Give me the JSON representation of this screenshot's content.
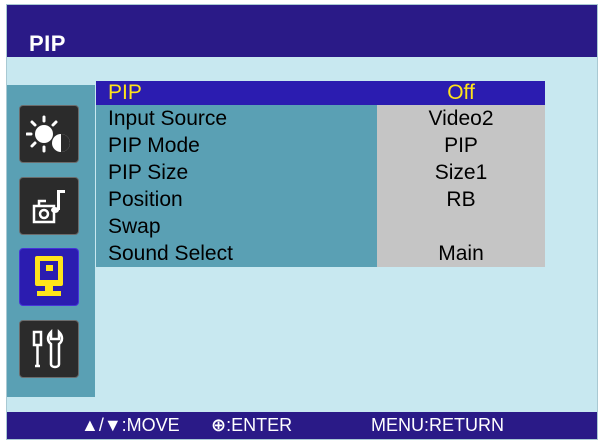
{
  "osd": {
    "title": "PIP",
    "sidebar": {
      "items": [
        {
          "icon": "brightness-contrast-icon",
          "active": false
        },
        {
          "icon": "audio-settings-icon",
          "active": false
        },
        {
          "icon": "pip-monitor-icon",
          "active": true
        },
        {
          "icon": "tools-icon",
          "active": false
        }
      ]
    },
    "menu": {
      "rows": [
        {
          "label": "PIP",
          "value": "Off",
          "selected": true
        },
        {
          "label": "Input Source",
          "value": "Video2",
          "selected": false
        },
        {
          "label": "PIP Mode",
          "value": "PIP",
          "selected": false
        },
        {
          "label": "PIP Size",
          "value": "Size1",
          "selected": false
        },
        {
          "label": "Position",
          "value": "RB",
          "selected": false
        },
        {
          "label": "Swap",
          "value": "",
          "selected": false
        },
        {
          "label": "Sound Select",
          "value": "Main",
          "selected": false
        }
      ]
    },
    "footer": {
      "move_label": "▲/▼:MOVE",
      "enter_symbol": "⊕",
      "enter_label": ":ENTER",
      "return_label": "MENU:RETURN"
    },
    "colors": {
      "title_bar": "#2a1a87",
      "background": "#c8e8f0",
      "label_column": "#5aa0b4",
      "value_column": "#c5c5c5",
      "selected_background": "#2b1cb0",
      "selected_text": "#ffe41a"
    }
  }
}
